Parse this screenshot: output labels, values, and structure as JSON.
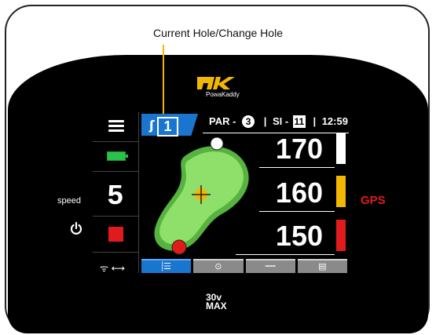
{
  "callout": {
    "label": "Current Hole/Change Hole"
  },
  "logo": {
    "brand": "PowaKaddy",
    "mark": "PK"
  },
  "rail": {
    "speed_label": "speed",
    "speed_value": "5",
    "power_icon": "power-icon",
    "stop_icon": "stop-square-icon",
    "connectivity": "ᯤ ⟷"
  },
  "header": {
    "hole_number": "1",
    "par_label": "PAR -",
    "par_value": "3",
    "si_label": "SI -",
    "si_value": "11",
    "time": "12:59"
  },
  "distances": [
    {
      "value": "170",
      "marker": "back",
      "color": "#ffffff"
    },
    {
      "value": "160",
      "marker": "middle",
      "color": "#f2b705"
    },
    {
      "value": "150",
      "marker": "front",
      "color": "#e01b1b"
    }
  ],
  "gps_label": "GPS",
  "tabs": [
    {
      "icon": "hole-info-icon",
      "glyph": "⸽☰",
      "active": true
    },
    {
      "icon": "green-view-icon",
      "glyph": "⊙",
      "active": false
    },
    {
      "icon": "ruler-icon",
      "glyph": "┅┅",
      "active": false
    },
    {
      "icon": "scorecard-icon",
      "glyph": "▤",
      "active": false
    }
  ],
  "model": {
    "line1": "30v",
    "line2": "MAX"
  },
  "colors": {
    "accent": "#1a75cf",
    "green": "#7ed957",
    "yellow": "#f2b705",
    "red": "#e01b1b"
  }
}
